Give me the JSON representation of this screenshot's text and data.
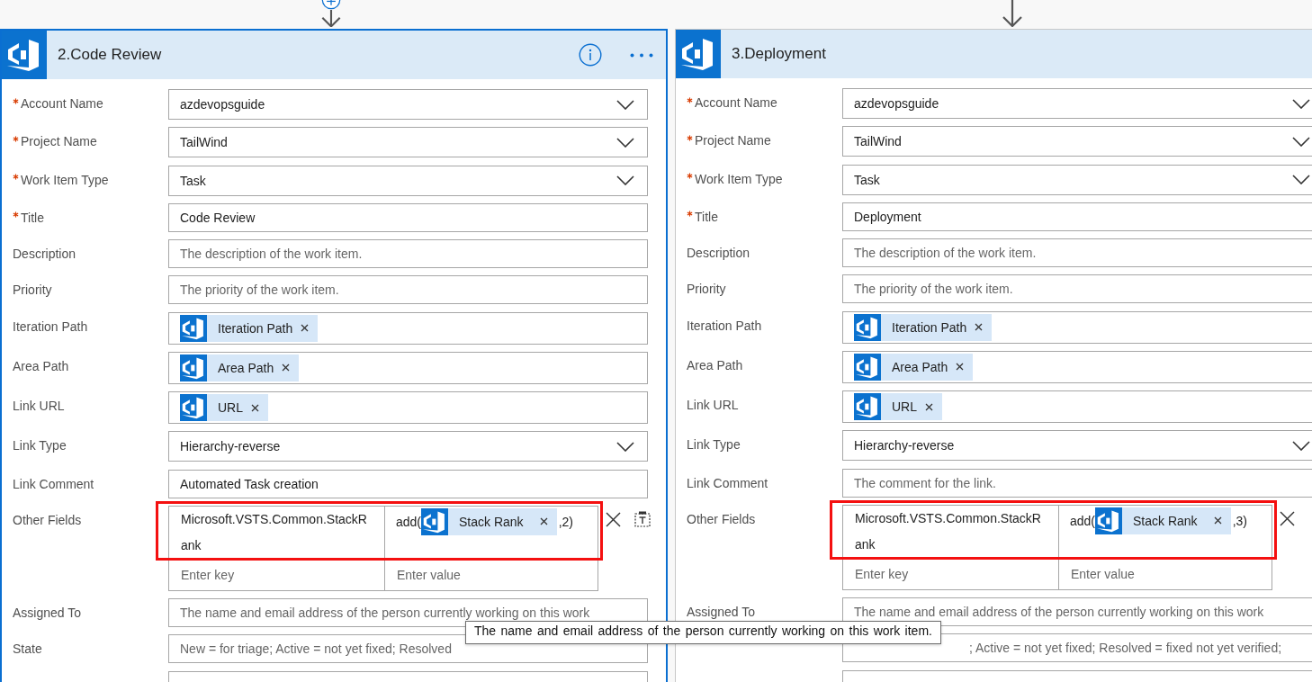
{
  "cards": [
    {
      "title": "2.Code Review",
      "selected": true,
      "has_actions": true,
      "insert_button": true,
      "fields": [
        {
          "kind": "dropdown",
          "label": "Account Name",
          "required": true,
          "value": "azdevopsguide"
        },
        {
          "kind": "dropdown",
          "label": "Project Name",
          "required": true,
          "value": "TailWind"
        },
        {
          "kind": "dropdown",
          "label": "Work Item Type",
          "required": true,
          "value": "Task"
        },
        {
          "kind": "text",
          "label": "Title",
          "required": true,
          "value": "Code Review"
        },
        {
          "kind": "text",
          "label": "Description",
          "required": false,
          "placeholder": "The description of the work item."
        },
        {
          "kind": "text",
          "label": "Priority",
          "required": false,
          "placeholder": "The priority of the work item."
        },
        {
          "kind": "tokens",
          "label": "Iteration Path",
          "required": false,
          "tokens": [
            {
              "label": "Iteration Path"
            }
          ]
        },
        {
          "kind": "tokens",
          "label": "Area Path",
          "required": false,
          "tokens": [
            {
              "label": "Area Path"
            }
          ]
        },
        {
          "kind": "tokens",
          "label": "Link URL",
          "required": false,
          "tokens": [
            {
              "label": "URL"
            }
          ]
        },
        {
          "kind": "dropdown",
          "label": "Link Type",
          "required": false,
          "value": "Hierarchy-reverse"
        },
        {
          "kind": "text",
          "label": "Link Comment",
          "required": false,
          "value": "Automated Task creation"
        },
        {
          "kind": "key_value",
          "label": "Other Fields",
          "required": false,
          "highlighted": true,
          "mode_toggle": true,
          "pairs": [
            {
              "key": "Microsoft.VSTS.Common.StackRank",
              "value": [
                {
                  "kind": "text",
                  "text": "add("
                },
                {
                  "kind": "token",
                  "label": "Stack Rank"
                },
                {
                  "kind": "text",
                  "text": ",2)"
                }
              ]
            }
          ],
          "new_pair": {
            "key_placeholder": "Enter key",
            "value_placeholder": "Enter value"
          }
        },
        {
          "kind": "text",
          "label": "Assigned To",
          "required": false,
          "placeholder": "The name and email address of the person currently working on this work"
        },
        {
          "kind": "text",
          "label": "State",
          "required": false,
          "placeholder": "New = for triage; Active = not yet fixed; Resolved"
        },
        {
          "kind": "cut_off"
        }
      ]
    },
    {
      "title": "3.Deployment",
      "selected": false,
      "has_actions": false,
      "insert_button": false,
      "fields": [
        {
          "kind": "dropdown",
          "label": "Account Name",
          "required": true,
          "value": "azdevopsguide"
        },
        {
          "kind": "dropdown",
          "label": "Project Name",
          "required": true,
          "value": "TailWind"
        },
        {
          "kind": "dropdown",
          "label": "Work Item Type",
          "required": true,
          "value": "Task"
        },
        {
          "kind": "text",
          "label": "Title",
          "required": true,
          "value": "Deployment"
        },
        {
          "kind": "text",
          "label": "Description",
          "required": false,
          "placeholder": "The description of the work item."
        },
        {
          "kind": "text",
          "label": "Priority",
          "required": false,
          "placeholder": "The priority of the work item."
        },
        {
          "kind": "tokens",
          "label": "Iteration Path",
          "required": false,
          "tokens": [
            {
              "label": "Iteration Path"
            }
          ]
        },
        {
          "kind": "tokens",
          "label": "Area Path",
          "required": false,
          "tokens": [
            {
              "label": "Area Path"
            }
          ]
        },
        {
          "kind": "tokens",
          "label": "Link URL",
          "required": false,
          "tokens": [
            {
              "label": "URL"
            }
          ]
        },
        {
          "kind": "dropdown",
          "label": "Link Type",
          "required": false,
          "value": "Hierarchy-reverse"
        },
        {
          "kind": "text",
          "label": "Link Comment",
          "required": false,
          "placeholder": "The comment for the link."
        },
        {
          "kind": "key_value",
          "label": "Other Fields",
          "required": false,
          "highlighted": true,
          "mode_toggle": false,
          "pairs": [
            {
              "key": "Microsoft.VSTS.Common.StackRank",
              "value": [
                {
                  "kind": "text",
                  "text": "add("
                },
                {
                  "kind": "token",
                  "label": "Stack Rank"
                },
                {
                  "kind": "text",
                  "text": ",3)"
                }
              ]
            }
          ],
          "new_pair": {
            "key_placeholder": "Enter key",
            "value_placeholder": "Enter value"
          }
        },
        {
          "kind": "text",
          "label": "Assigned To",
          "required": false,
          "placeholder": "The name and email address of the person currently working on this work"
        },
        {
          "kind": "text",
          "required": false,
          "covered_start": true,
          "placeholder": "; Active = not yet fixed; Resolved = fixed not yet verified;"
        },
        {
          "kind": "cut_off"
        }
      ]
    }
  ],
  "tooltip": {
    "text": "The name and email address of the person currently working on this work item."
  }
}
